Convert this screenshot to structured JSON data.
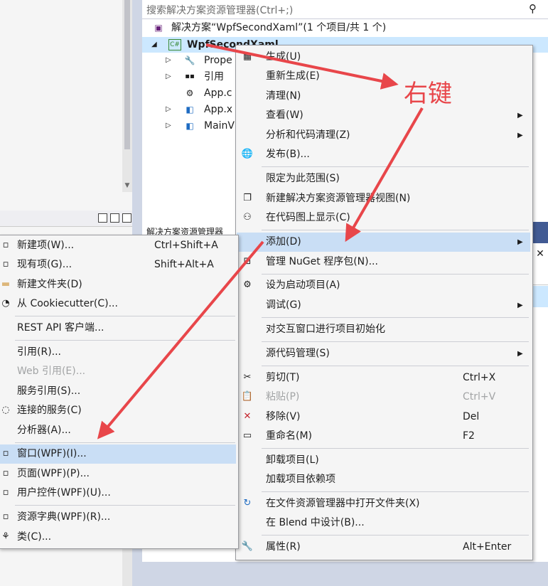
{
  "search": {
    "placeholder": "搜索解决方案资源管理器(Ctrl+;)"
  },
  "tree": {
    "solution": "解决方案“WpfSecondXaml”(1 个项目/共 1 个)",
    "project": "WpfSecondXaml",
    "project_badge": "C#",
    "items": [
      "Prope",
      "引用",
      "App.c",
      "App.x",
      "MainV"
    ]
  },
  "status_tab": "解决方案资源管理器",
  "annotation": "右键",
  "context_menu": {
    "items": [
      {
        "label": "生成(U)"
      },
      {
        "label": "重新生成(E)"
      },
      {
        "label": "清理(N)"
      },
      {
        "label": "查看(W)"
      },
      {
        "label": "分析和代码清理(Z)"
      },
      {
        "label": "发布(B)..."
      },
      {
        "label": "限定为此范围(S)"
      },
      {
        "label": "新建解决方案资源管理器视图(N)"
      },
      {
        "label": "在代码图上显示(C)"
      },
      {
        "label": "添加(D)"
      },
      {
        "label": "管理 NuGet 程序包(N)..."
      },
      {
        "label": "设为启动项目(A)"
      },
      {
        "label": "调试(G)"
      },
      {
        "label": "对交互窗口进行项目初始化"
      },
      {
        "label": "源代码管理(S)"
      },
      {
        "label": "剪切(T)",
        "shortcut": "Ctrl+X"
      },
      {
        "label": "粘贴(P)",
        "shortcut": "Ctrl+V"
      },
      {
        "label": "移除(V)",
        "shortcut": "Del"
      },
      {
        "label": "重命名(M)",
        "shortcut": "F2"
      },
      {
        "label": "卸载项目(L)"
      },
      {
        "label": "加载项目依赖项"
      },
      {
        "label": "在文件资源管理器中打开文件夹(X)"
      },
      {
        "label": "在 Blend 中设计(B)..."
      },
      {
        "label": "属性(R)",
        "shortcut": "Alt+Enter"
      }
    ]
  },
  "submenu": {
    "items": [
      {
        "label": "新建项(W)...",
        "shortcut": "Ctrl+Shift+A"
      },
      {
        "label": "现有项(G)...",
        "shortcut": "Shift+Alt+A"
      },
      {
        "label": "新建文件夹(D)"
      },
      {
        "label": "从 Cookiecutter(C)..."
      },
      {
        "label": "REST API 客户端..."
      },
      {
        "label": "引用(R)..."
      },
      {
        "label": "Web 引用(E)..."
      },
      {
        "label": "服务引用(S)..."
      },
      {
        "label": "连接的服务(C)"
      },
      {
        "label": "分析器(A)..."
      },
      {
        "label": "窗口(WPF)(I)..."
      },
      {
        "label": "页面(WPF)(P)..."
      },
      {
        "label": "用户控件(WPF)(U)..."
      },
      {
        "label": "资源字典(WPF)(R)..."
      },
      {
        "label": "类(C)..."
      }
    ]
  },
  "colors": {
    "accent_highlight": "#c9def5",
    "selection": "#cce8ff",
    "annotation_red": "#e8464a"
  }
}
